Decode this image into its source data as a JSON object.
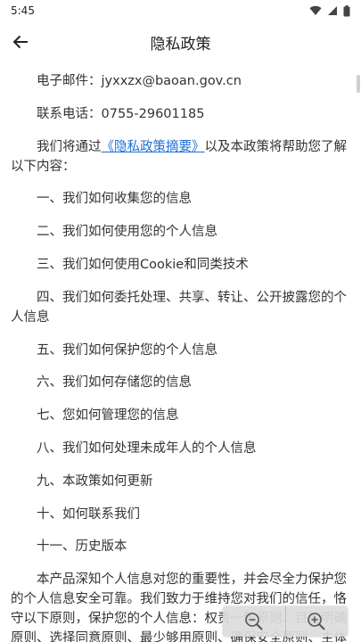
{
  "status_bar": {
    "time": "5:45",
    "icons": [
      "wifi-icon",
      "signal-icon",
      "battery-icon"
    ]
  },
  "app_bar": {
    "title": "隐私政策",
    "back_icon": "arrow-left-icon"
  },
  "content": {
    "email_line": "电子邮件：jyxxzx@baoan.gov.cn",
    "phone_line": "联系电话：0755-29601185",
    "intro_prefix": "我们将通过",
    "intro_link": "《隐私政策摘要》",
    "intro_suffix": "以及本政策将帮助您了解以下内容：",
    "toc": [
      "一、我们如何收集您的信息",
      "二、我们如何使用您的个人信息",
      "三、我们如何使用Cookie和同类技术",
      "四、我们如何委托处理、共享、转让、公开披露您的个人信息",
      "五、我们如何保护您的个人信息",
      "六、我们如何存储您的信息",
      "七、您如何管理您的信息",
      "八、我们如何处理未成年人的个人信息",
      "九、本政策如何更新",
      "十、如何联系我们",
      "十一、历史版本"
    ],
    "closing": "本产品深知个人信息对您的重要性，并会尽全力保护您的个人信息安全可靠。我们致力于维持您对我们的信任，恪守以下原则，保护您的个人信息：权责一致原则、目的明确原则、选择同意原则、最少够用原则、确保安全原则、主体参与原则、公开透明原则等。"
  },
  "zoom_controls": {
    "zoom_out_icon": "zoom-out-icon",
    "zoom_in_icon": "zoom-in-icon"
  },
  "colors": {
    "link": "#1d6fd6",
    "text": "#333333",
    "background": "#ffffff"
  }
}
